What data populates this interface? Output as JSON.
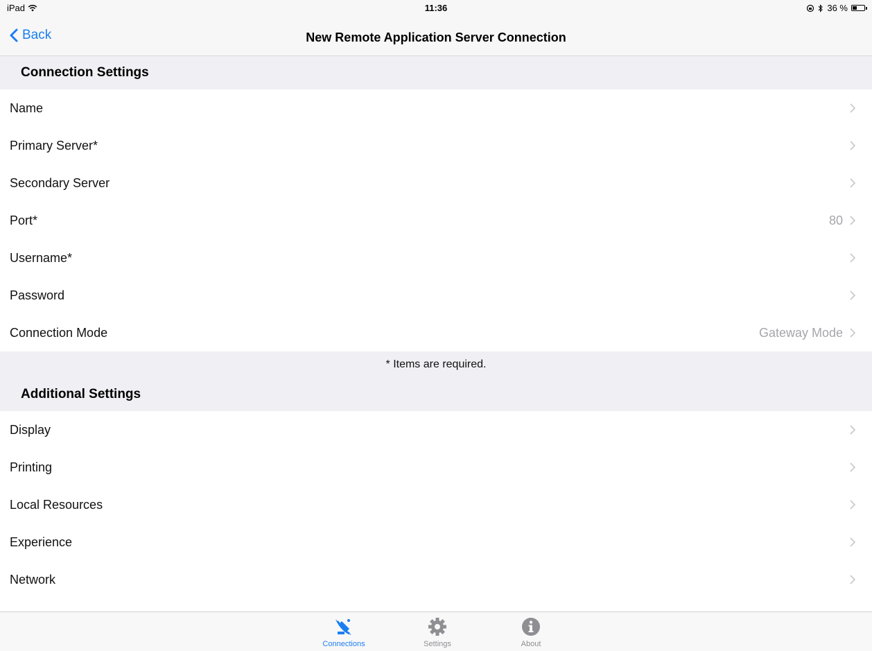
{
  "status_bar": {
    "device": "iPad",
    "time": "11:36",
    "battery_percent": "36 %",
    "battery_level": 0.36
  },
  "nav": {
    "back_label": "Back",
    "title": "New Remote Application Server Connection"
  },
  "connection_settings": {
    "header": "Connection Settings",
    "rows": [
      {
        "label": "Name",
        "value": ""
      },
      {
        "label": "Primary Server*",
        "value": ""
      },
      {
        "label": "Secondary Server",
        "value": ""
      },
      {
        "label": "Port*",
        "value": "80"
      },
      {
        "label": "Username*",
        "value": ""
      },
      {
        "label": "Password",
        "value": ""
      },
      {
        "label": "Connection Mode",
        "value": "Gateway Mode"
      }
    ],
    "footer": "* Items are required."
  },
  "additional_settings": {
    "header": "Additional Settings",
    "rows": [
      {
        "label": "Display"
      },
      {
        "label": "Printing"
      },
      {
        "label": "Local Resources"
      },
      {
        "label": "Experience"
      },
      {
        "label": "Network"
      }
    ]
  },
  "tab_bar": {
    "tabs": [
      {
        "label": "Connections",
        "icon": "satellite-dish-icon",
        "active": true
      },
      {
        "label": "Settings",
        "icon": "gear-icon",
        "active": false
      },
      {
        "label": "About",
        "icon": "info-icon",
        "active": false
      }
    ]
  },
  "colors": {
    "accent": "#1a7ef2",
    "inactive": "#8e8e93",
    "secondary_text": "#a6a6ab",
    "group_background": "#efeff4"
  }
}
